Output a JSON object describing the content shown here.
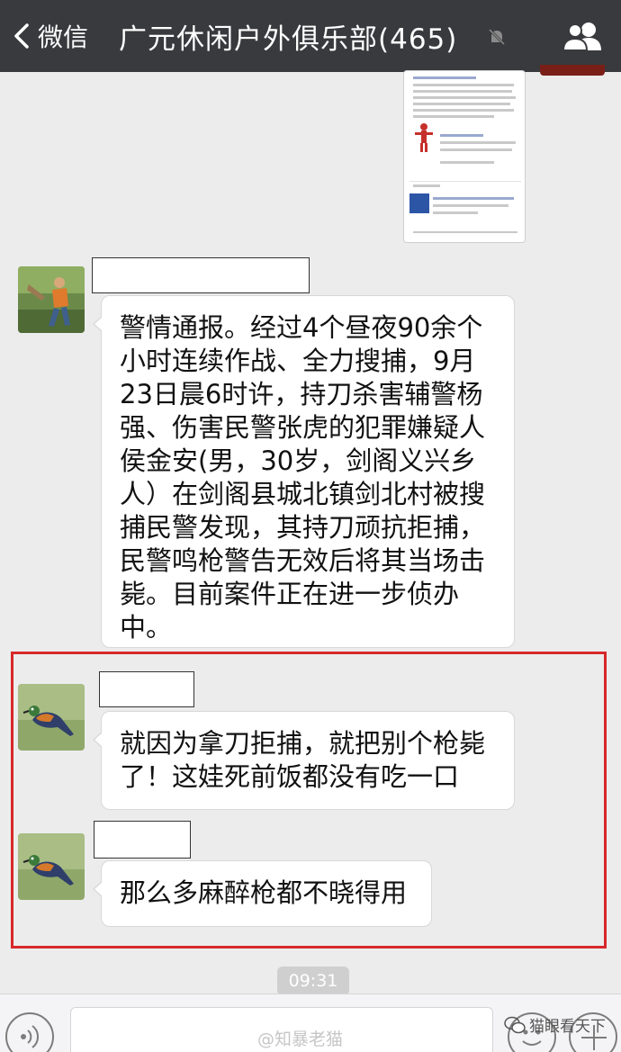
{
  "header": {
    "back_label": "微信",
    "title": "广元休闲户外俱乐部(465)"
  },
  "messages": [
    {
      "lines": [
        "警情通报。经过4个昼夜90余个",
        "小时连续作战、全力搜捕，9月",
        "23日晨6时许，持刀杀害辅警杨",
        "强、伤害民警张虎的犯罪嫌疑人",
        "侯金安(男，30岁，剑阁义兴乡",
        "人）在剑阁县城北镇剑北村被搜",
        "捕民警发现，其持刀顽抗拒捕，",
        "民警鸣枪警告无效后将其当场击",
        "毙。目前案件正在进一步侦办",
        "中。"
      ]
    },
    {
      "lines": [
        "就因为拿刀拒捕，就把别个枪毙",
        "了！这娃死前饭都没有吃一口"
      ]
    },
    {
      "lines": [
        "那么多麻醉枪都不晓得用"
      ]
    }
  ],
  "timestamp": "09:31",
  "watermarks": {
    "weibo": "@知暴老猫",
    "wechat": "猫眼看天下"
  },
  "colors": {
    "header_bg": "#393a3e",
    "chat_bg": "#ececec",
    "highlight_border": "#d7282a"
  }
}
